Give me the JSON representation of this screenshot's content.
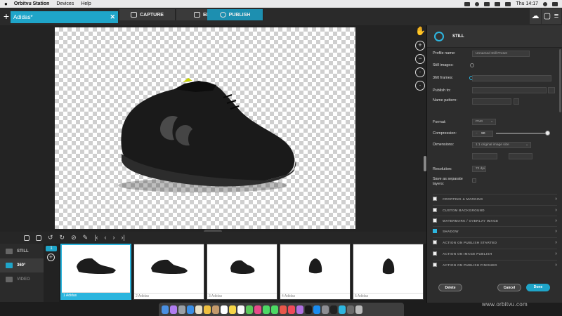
{
  "menubar": {
    "app_name": "Orbitvu Station",
    "items": [
      "Devices",
      "Help"
    ],
    "clock": "Thu 14:17"
  },
  "toolbar": {
    "doc_tab_label": "Adidas*",
    "tabs": [
      {
        "label": "CAPTURE",
        "icon": "camera-icon"
      },
      {
        "label": "EDIT",
        "icon": "edit-icon"
      },
      {
        "label": "PUBLISH",
        "icon": "publish-icon"
      }
    ]
  },
  "left_modes": [
    {
      "label": "STILL",
      "icon": "still-icon"
    },
    {
      "label": "360°",
      "icon": "360-icon"
    },
    {
      "label": "VIDEO",
      "icon": "video-icon"
    }
  ],
  "frame": {
    "number": "1"
  },
  "thumbnails": [
    {
      "label": "1 Adidas"
    },
    {
      "label": "2 Adidas"
    },
    {
      "label": "3 Adidas"
    },
    {
      "label": "4 Adidas"
    },
    {
      "label": "5 Adidas"
    }
  ],
  "panel": {
    "title": "STILL",
    "profile_name_label": "Profile name:",
    "profile_name_value": "Unnamed Still Preset",
    "still_images_label": "Still images:",
    "frames_360_label": "360 frames:",
    "publish_to_label": "Publish to:",
    "name_pattern_label": "Name pattern:",
    "format_label": "Format:",
    "format_value": "PNG",
    "compression_label": "Compression:",
    "compression_value": "90",
    "dimensions_label": "Dimensions:",
    "dimensions_value": "1:1 original image size",
    "resolution_label": "Resolution:",
    "resolution_value": "72 dpi",
    "save_layers_label": "Save as separate layers:",
    "sections": [
      {
        "label": "CROPPING & MARGINS",
        "checked": false
      },
      {
        "label": "CUSTOM BACKGROUND",
        "checked": false
      },
      {
        "label": "WATERMARK / OVERLAY IMAGE",
        "checked": false
      },
      {
        "label": "SHADOW",
        "checked": true
      },
      {
        "label": "ACTION ON PUBLISH STARTED",
        "checked": false
      },
      {
        "label": "ACTION ON IMAGE PUBLISH",
        "checked": false
      },
      {
        "label": "ACTION ON PUBLISH FINISHED",
        "checked": false
      }
    ],
    "delete_label": "Delete",
    "cancel_label": "Cancel",
    "done_label": "Done"
  },
  "watermark": "www.orbitvu.com",
  "colors": {
    "accent": "#1fa5c9",
    "panel_bg": "#2d2d2d",
    "canvas_bg": "#232323"
  }
}
